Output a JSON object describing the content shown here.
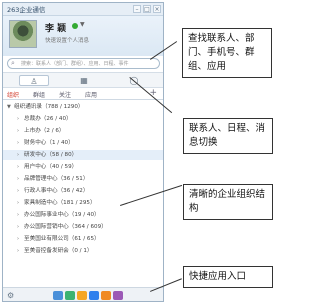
{
  "window": {
    "title": "263企业通信"
  },
  "profile": {
    "name": "李 颖",
    "motto": "快速设置个人消息"
  },
  "search": {
    "placeholder": "搜索：联系人（部门、群组）、应用、日程、事件"
  },
  "toolbar": {
    "contacts_icon": "person-icon",
    "calendar_icon": "calendar-icon",
    "messages_icon": "chat-bubble-icon"
  },
  "subtabs": [
    {
      "label": "组织"
    },
    {
      "label": "群组"
    },
    {
      "label": "关注"
    },
    {
      "label": "应用"
    }
  ],
  "tree": {
    "root": "组织通讯录（788 / 1290）",
    "items": [
      "总裁办（26 / 40）",
      "上市办（2 / 6）",
      "财务中心（1 / 40）",
      "研发中心（58 / 80）",
      "用户中心（40 / 59）",
      "品牌管理中心（36 / 51）",
      "行政人事中心（36 / 42）",
      "家具制造中心（181 / 295）",
      "办公国际事业中心（19 / 40）",
      "办公国际营销中心（364 / 609）",
      "至美国业有限公司（61 / 65）",
      "至美音控备发研会（0 / 1）"
    ]
  },
  "callouts": {
    "search": "查找联系人、部门、手机号、群组、应用",
    "switch": "联系人、日程、消息切换",
    "org": "清晰的企业组织结构",
    "apps": "快捷应用入口"
  },
  "colors": {
    "accent": "#d23c2c",
    "app_icons": [
      "#4a90d9",
      "#3cb371",
      "#f5a623",
      "#2f80ed",
      "#f08a24",
      "#9b59b6"
    ]
  }
}
